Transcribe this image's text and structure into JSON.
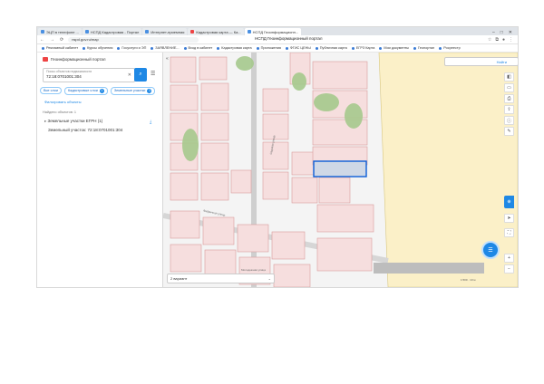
{
  "browser": {
    "tabs": [
      {
        "label": "ЭЦП в телефоне ...",
        "active": false
      },
      {
        "label": "НСПД Кадастровая - Портал",
        "active": false
      },
      {
        "label": "Интернет-приемная",
        "active": false
      },
      {
        "label": "Кадастровая карта — Ка...",
        "active": false
      },
      {
        "label": "НСПД Геоинформационн...",
        "active": true
      }
    ],
    "page_title": "НСПД Геоинформационный портал",
    "url": "nspd.gov.ru/map",
    "bookmarks": [
      "Рекламный кабинет",
      "Курсы обучения",
      "Госуслуги и ЭП",
      "ЗАЯВЛЕНИЕ...",
      "Вход в кабинет",
      "Кадастровая карта",
      "Приложения",
      "ФГИС ЦЕНЫ",
      "Публичная карта",
      "ЕГРЗ Карта",
      "Мои документы",
      "Геопортал",
      "Росреестр"
    ]
  },
  "panel": {
    "brand": "Геоинформационный портал",
    "search_hint": "Поиск объектов недвижимости",
    "search_value": "72:18:0701001:304",
    "chips": [
      {
        "label": "Все слои",
        "count": ""
      },
      {
        "label": "Кадастровые слои",
        "count": "1"
      },
      {
        "label": "Земельные участки",
        "count": "1"
      }
    ],
    "filter_link": "Фильтровать объекты",
    "found_label": "Найдено объектов: 1",
    "result_title": "Земельные участки ЕГРН (1)",
    "result_item": "Земельный участок: 72:18:0701001:304"
  },
  "map": {
    "search_label": "Найти",
    "basemap": "2 вариант",
    "scale": "1:500 · 10 м",
    "road_labels": [
      "Садовая улица",
      "Фабричная улица",
      "Молодежная улица"
    ],
    "colors": {
      "parcel": "#f6dede",
      "parcel_stroke": "#d99b9b",
      "selected": "#0b5ed7",
      "field": "#fbf0c8",
      "green": "#a6c98d",
      "road": "#bdbdbd"
    }
  },
  "tools": [
    "layers-icon",
    "ruler-icon",
    "print-icon",
    "share-icon",
    "info-icon",
    "draw-icon"
  ]
}
